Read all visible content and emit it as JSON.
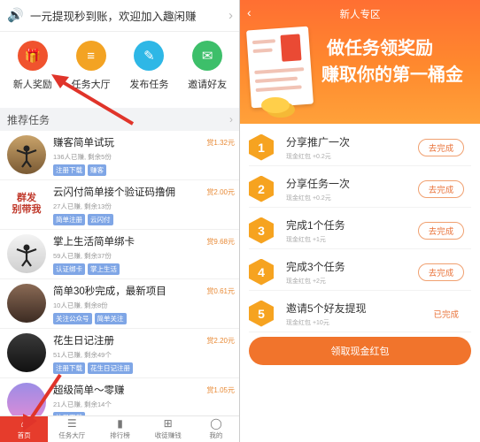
{
  "left": {
    "notice": "一元提现秒到账，欢迎加入趣闲赚",
    "quick": [
      {
        "label": "新人奖励",
        "color": "#f0532e",
        "glyph": "🎁",
        "icon": "gift-icon"
      },
      {
        "label": "任务大厅",
        "color": "#f3a323",
        "glyph": "≡",
        "icon": "task-hall-icon"
      },
      {
        "label": "发布任务",
        "color": "#2eb7e6",
        "glyph": "✎",
        "icon": "publish-icon"
      },
      {
        "label": "邀请好友",
        "color": "#3dbf6a",
        "glyph": "✉",
        "icon": "invite-icon"
      }
    ],
    "section_title": "推荐任务",
    "tasks": [
      {
        "title": "赚客简单试玩",
        "meta": "136人已赚, 剩余5份",
        "tags": [
          "注册下载",
          "赚客"
        ],
        "price": "赏1.32元"
      },
      {
        "title": "云闪付简单接个验证码撸佣",
        "meta": "27人已赚, 剩余13份",
        "tags": [
          "简单注册",
          "云闪付"
        ],
        "price": "赏2.00元"
      },
      {
        "title": "掌上生活简单绑卡",
        "meta": "59人已赚, 剩余37份",
        "tags": [
          "认证绑卡",
          "掌上生活"
        ],
        "price": "赏9.68元"
      },
      {
        "title": "简单30秒完成，最新项目",
        "meta": "10人已赚, 剩余8份",
        "tags": [
          "关注公众号",
          "简单关注"
        ],
        "price": "赏0.61元"
      },
      {
        "title": "花生日记注册",
        "meta": "51人已赚, 剩余49个",
        "tags": [
          "注册下载",
          "花生日记注册"
        ],
        "price": "赏2.20元"
      },
      {
        "title": "超级简单～零赚",
        "meta": "21人已赚, 剩余14个",
        "tags": [
          "注册下载"
        ],
        "price": "赏1.05元"
      }
    ],
    "thumb_text": "群发\n别带我",
    "tabs": [
      {
        "label": "首页",
        "glyph": "⌂",
        "icon": "home-icon"
      },
      {
        "label": "任务大厅",
        "glyph": "☰",
        "icon": "task-hall-icon"
      },
      {
        "label": "排行榜",
        "glyph": "▮",
        "icon": "ranking-icon"
      },
      {
        "label": "收徒赚钱",
        "glyph": "⊞",
        "icon": "apprentice-icon"
      },
      {
        "label": "我的",
        "glyph": "◯",
        "icon": "profile-icon"
      }
    ]
  },
  "right": {
    "title": "新人专区",
    "head1": "做任务领奖励",
    "head2": "赚取你的第一桶金",
    "items": [
      {
        "num": "1",
        "name": "分享推广一次",
        "sub": "现金红包 +0.2元",
        "action": "去完成",
        "done": false
      },
      {
        "num": "2",
        "name": "分享任务一次",
        "sub": "现金红包 +0.2元",
        "action": "去完成",
        "done": false
      },
      {
        "num": "3",
        "name": "完成1个任务",
        "sub": "现金红包 +1元",
        "action": "去完成",
        "done": false
      },
      {
        "num": "4",
        "name": "完成3个任务",
        "sub": "现金红包 +2元",
        "action": "去完成",
        "done": false
      },
      {
        "num": "5",
        "name": "邀请5个好友提现",
        "sub": "现金红包 +10元",
        "action": "已完成",
        "done": true
      }
    ],
    "cta": "领取现金红包"
  },
  "colors": {
    "accent": "#f1742c",
    "hex": "#f6a320",
    "tab_active": "#e63c2c",
    "tag": "#7fa6e6"
  }
}
